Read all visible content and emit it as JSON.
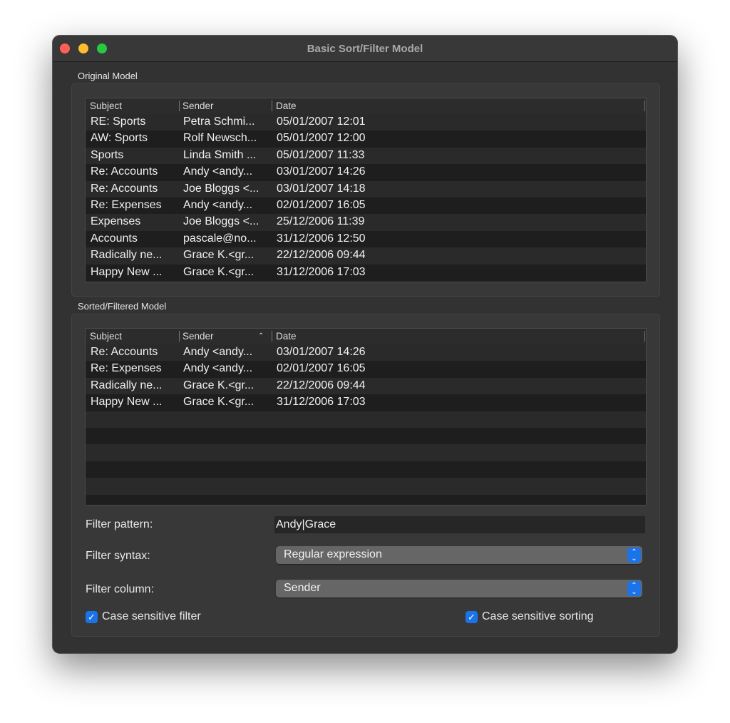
{
  "window": {
    "title": "Basic Sort/Filter Model"
  },
  "original": {
    "label": "Original Model",
    "columns": [
      "Subject",
      "Sender",
      "Date"
    ],
    "rows": [
      [
        "RE: Sports",
        "Petra Schmi...",
        "05/01/2007 12:01"
      ],
      [
        "AW: Sports",
        "Rolf Newsch...",
        "05/01/2007 12:00"
      ],
      [
        "Sports",
        "Linda Smith ...",
        "05/01/2007 11:33"
      ],
      [
        "Re: Accounts",
        "Andy <andy...",
        "03/01/2007 14:26"
      ],
      [
        "Re: Accounts",
        "Joe Bloggs <...",
        "03/01/2007 14:18"
      ],
      [
        "Re: Expenses",
        "Andy <andy...",
        "02/01/2007 16:05"
      ],
      [
        "Expenses",
        "Joe Bloggs <...",
        "25/12/2006 11:39"
      ],
      [
        "Accounts",
        "pascale@no...",
        "31/12/2006 12:50"
      ],
      [
        "Radically ne...",
        "Grace K.<gr...",
        "22/12/2006 09:44"
      ],
      [
        "Happy New ...",
        "Grace K.<gr...",
        "31/12/2006 17:03"
      ]
    ]
  },
  "sorted": {
    "label": "Sorted/Filtered Model",
    "columns": [
      "Subject",
      "Sender",
      "Date"
    ],
    "sort_column": "Sender",
    "sort_order": "ascending",
    "rows": [
      [
        "Re: Accounts",
        "Andy <andy...",
        "03/01/2007 14:26"
      ],
      [
        "Re: Expenses",
        "Andy <andy...",
        "02/01/2007 16:05"
      ],
      [
        "Radically ne...",
        "Grace K.<gr...",
        "22/12/2006 09:44"
      ],
      [
        "Happy New ...",
        "Grace K.<gr...",
        "31/12/2006 17:03"
      ]
    ]
  },
  "filter": {
    "pattern_label": "Filter pattern:",
    "pattern_value": "Andy|Grace",
    "syntax_label": "Filter syntax:",
    "syntax_value": "Regular expression",
    "column_label": "Filter column:",
    "column_value": "Sender",
    "case_filter_label": "Case sensitive filter",
    "case_filter_checked": true,
    "case_sort_label": "Case sensitive sorting",
    "case_sort_checked": true
  },
  "colors": {
    "accent": "#1a73e8",
    "close": "#ff5f57",
    "minimize": "#febc2e",
    "zoom": "#28c840"
  }
}
